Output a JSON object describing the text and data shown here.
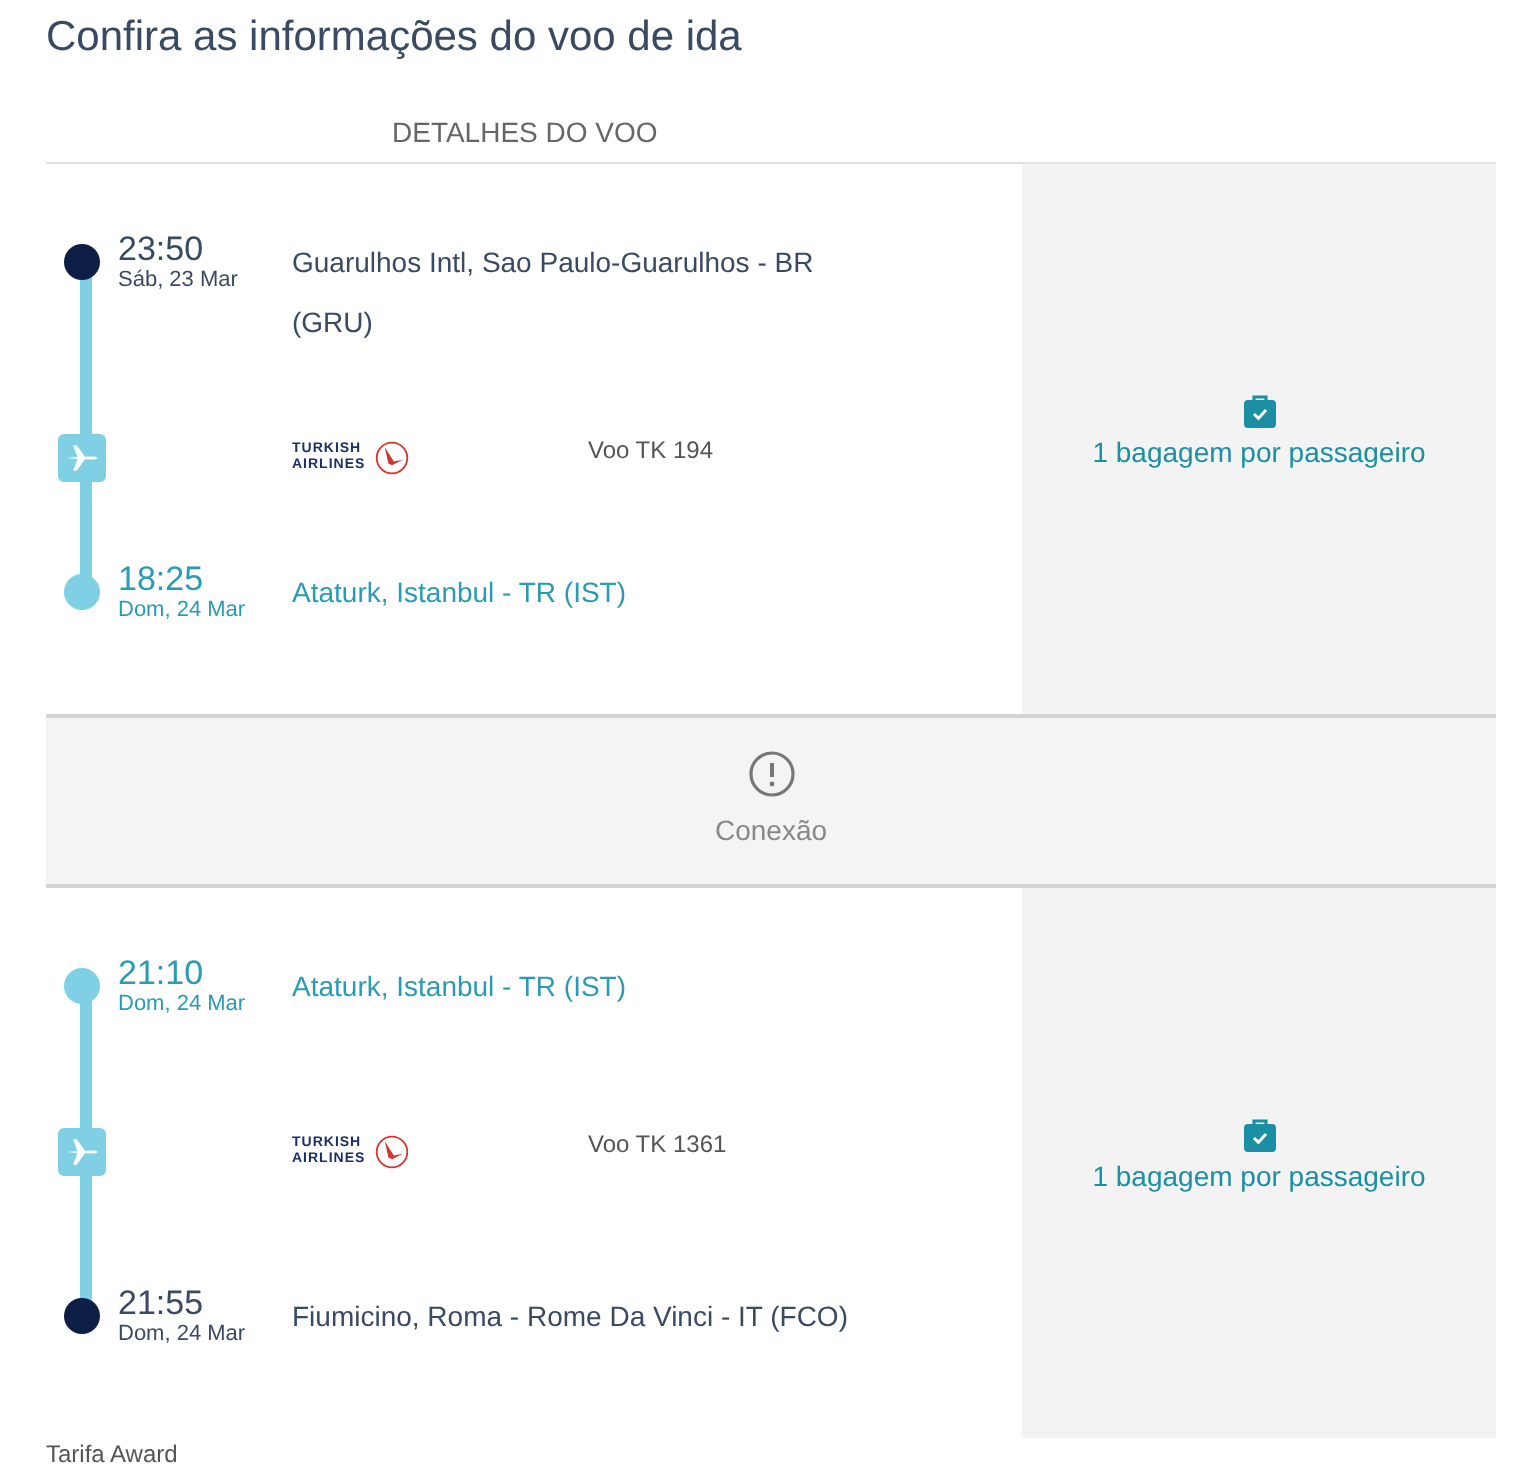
{
  "title": "Confira as informações do voo de ida",
  "section_heading": "DETALHES DO VOO",
  "segments": [
    {
      "departure": {
        "kind": "endpoint",
        "time": "23:50",
        "date": "Sáb, 23 Mar",
        "place": "Guarulhos Intl, Sao Paulo-Guarulhos - BR (GRU)"
      },
      "airline_logo": [
        "TURKISH",
        "AIRLINES"
      ],
      "flight": "Voo TK 194",
      "arrival": {
        "kind": "connection",
        "time": "18:25",
        "date": "Dom, 24 Mar",
        "place": "Ataturk, Istanbul - TR (IST)"
      },
      "baggage": "1 bagagem por passageiro"
    },
    {
      "departure": {
        "kind": "connection",
        "time": "21:10",
        "date": "Dom, 24 Mar",
        "place": "Ataturk, Istanbul - TR (IST)"
      },
      "airline_logo": [
        "TURKISH",
        "AIRLINES"
      ],
      "flight": "Voo TK 1361",
      "arrival": {
        "kind": "endpoint",
        "time": "21:55",
        "date": "Dom, 24 Mar",
        "place": "Fiumicino, Roma - Rome Da Vinci - IT (FCO)"
      },
      "baggage": "1 bagagem por passageiro"
    }
  ],
  "connection_label": "Conexão",
  "fare": "Tarifa Award"
}
